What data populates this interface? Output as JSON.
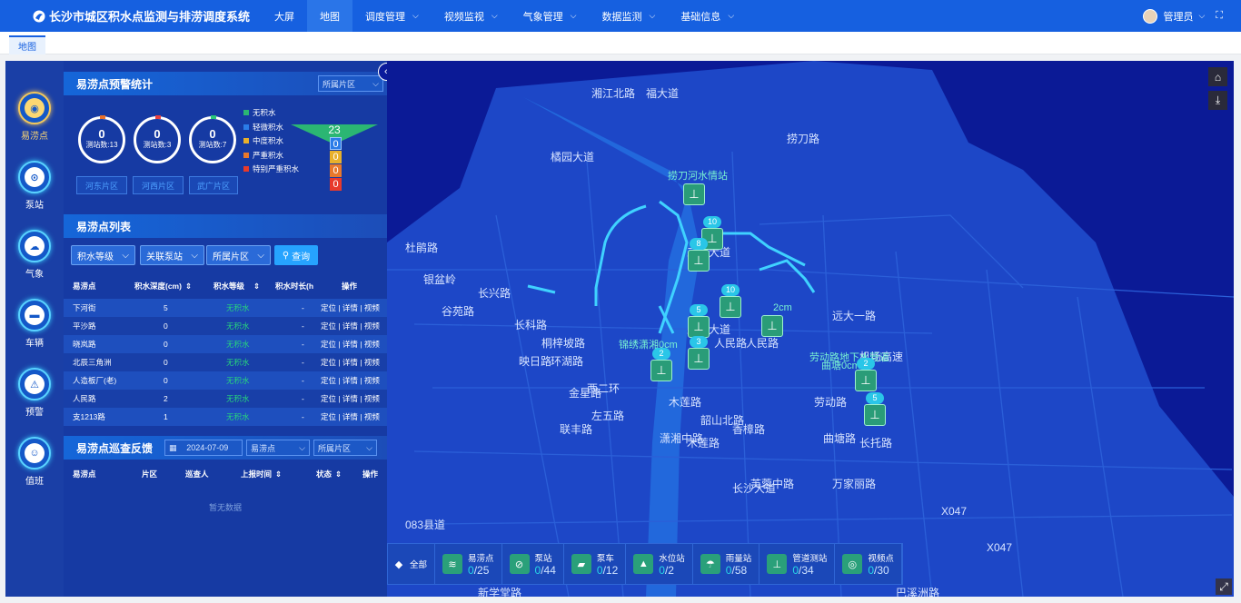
{
  "app": {
    "title": "长沙市城区积水点监测与排涝调度系统",
    "user": "管理员"
  },
  "nav": [
    {
      "label": "大屏",
      "has_menu": false
    },
    {
      "label": "地图",
      "has_menu": false,
      "active": true
    },
    {
      "label": "调度管理",
      "has_menu": true
    },
    {
      "label": "视频监视",
      "has_menu": true
    },
    {
      "label": "气象管理",
      "has_menu": true
    },
    {
      "label": "数据监测",
      "has_menu": true
    },
    {
      "label": "基础信息",
      "has_menu": true
    }
  ],
  "tabs": [
    {
      "label": "地图"
    }
  ],
  "sidebar": {
    "items": [
      {
        "label": "易涝点",
        "icon": "waterlogging-point-icon",
        "active": true
      },
      {
        "label": "泵站",
        "icon": "pump-station-icon"
      },
      {
        "label": "气象",
        "icon": "weather-icon"
      },
      {
        "label": "车辆",
        "icon": "vehicle-icon"
      },
      {
        "label": "预警",
        "icon": "warning-icon"
      },
      {
        "label": "值班",
        "icon": "duty-icon"
      }
    ]
  },
  "stats": {
    "title": "易涝点预警统计",
    "area_select": "所属片区",
    "rings": [
      {
        "value": "0",
        "label": "测站数:13",
        "accent": "#e8702a"
      },
      {
        "value": "0",
        "label": "测站数:3",
        "accent": "#e84040"
      },
      {
        "value": "0",
        "label": "测站数:7",
        "accent": "#29c77a"
      }
    ],
    "legend": [
      {
        "label": "无积水",
        "color": "#2bb673"
      },
      {
        "label": "轻微积水",
        "color": "#2b7ce8"
      },
      {
        "label": "中度积水",
        "color": "#e8b02b"
      },
      {
        "label": "严重积水",
        "color": "#e8782b"
      },
      {
        "label": "特别严重积水",
        "color": "#e83a2b"
      }
    ],
    "total": "23",
    "levels": [
      {
        "value": "0",
        "color": "#2b7ce8"
      },
      {
        "value": "0",
        "color": "#e8b02b"
      },
      {
        "value": "0",
        "color": "#e8782b"
      },
      {
        "value": "0",
        "color": "#e83a2b"
      }
    ],
    "zones": [
      "河东片区",
      "河西片区",
      "武广片区"
    ]
  },
  "list": {
    "title": "易涝点列表",
    "filters": [
      "积水等级",
      "关联泵站",
      "所属片区"
    ],
    "query": "查询",
    "columns": [
      "易涝点",
      "积水深度(cm)",
      "积水等级",
      "积水时长(h",
      "操作"
    ],
    "rows": [
      {
        "name": "下河街",
        "depth": "5",
        "level": "无积水",
        "duration": "-",
        "actions": "定位 | 详情 | 视频"
      },
      {
        "name": "平沙路",
        "depth": "0",
        "level": "无积水",
        "duration": "-",
        "actions": "定位 | 详情 | 视频"
      },
      {
        "name": "晓岚路",
        "depth": "0",
        "level": "无积水",
        "duration": "-",
        "actions": "定位 | 详情 | 视频"
      },
      {
        "name": "北辰三角洲",
        "depth": "0",
        "level": "无积水",
        "duration": "-",
        "actions": "定位 | 详情 | 视频"
      },
      {
        "name": "人造板厂(老)",
        "depth": "0",
        "level": "无积水",
        "duration": "-",
        "actions": "定位 | 详情 | 视频"
      },
      {
        "name": "人民路",
        "depth": "2",
        "level": "无积水",
        "duration": "-",
        "actions": "定位 | 详情 | 视频"
      },
      {
        "name": "支1213路",
        "depth": "1",
        "level": "无积水",
        "duration": "-",
        "actions": "定位 | 详情 | 视频"
      }
    ]
  },
  "patrol": {
    "title": "易涝点巡查反馈",
    "date": "2024-07-09",
    "type_select": "易涝点",
    "area_select": "所属片区",
    "columns": [
      "易涝点",
      "片区",
      "巡查人",
      "上报时间",
      "状态",
      "操作"
    ],
    "empty": "暂无数据"
  },
  "map": {
    "roads": [
      "福大道",
      "湘江北路",
      "捞刀路",
      "橘园大道",
      "三一大道",
      "杜鹃路",
      "银盆岭",
      "长兴路",
      "谷苑路",
      "长科路",
      "映日路",
      "环湖路",
      "金星路",
      "桐梓坡路",
      "西二环",
      "潇湘中路",
      "五一大道",
      "人民路",
      "人民路",
      "远大一路",
      "机场高速",
      "芙蓉中路",
      "韶山北路",
      "劳动路",
      "曲塘路",
      "长托路",
      "左五路",
      "联丰路",
      "木莲路",
      "香樟路",
      "木莲路",
      "万家丽路",
      "长沙大道",
      "083县道",
      "X047",
      "X047",
      "新学堂路",
      "巴溪洲路"
    ],
    "labels": [
      "捞刀河水情站",
      "2cm",
      "锦绣潇湘0cm",
      "劳动路地下水管道",
      "曲塘0cm"
    ],
    "markers": [
      {
        "count": "10"
      },
      {
        "count": "8"
      },
      {
        "count": "10"
      },
      {
        "count": "5"
      },
      {
        "count": "3"
      },
      {
        "count": "2"
      },
      {
        "count": "2"
      },
      {
        "count": "5"
      }
    ]
  },
  "layers": [
    {
      "label": "全部",
      "icon": "all-layers-icon"
    },
    {
      "label": "易涝点",
      "current": "0",
      "total": "/25",
      "icon": "waterlogging-point-icon"
    },
    {
      "label": "泵站",
      "current": "0",
      "total": "/44",
      "icon": "pump-station-icon"
    },
    {
      "label": "泵车",
      "current": "0",
      "total": "/12",
      "icon": "pump-truck-icon"
    },
    {
      "label": "水位站",
      "current": "0",
      "total": "/2",
      "icon": "water-level-icon"
    },
    {
      "label": "雨量站",
      "current": "0",
      "total": "/58",
      "icon": "rain-gauge-icon"
    },
    {
      "label": "管道测站",
      "current": "0",
      "total": "/34",
      "icon": "pipe-station-icon"
    },
    {
      "label": "视频点",
      "current": "0",
      "total": "/30",
      "icon": "video-point-icon"
    }
  ]
}
